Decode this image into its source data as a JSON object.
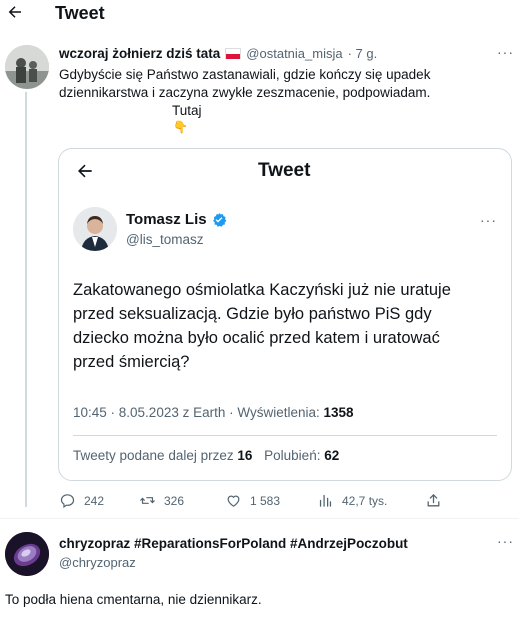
{
  "header": {
    "title": "Tweet"
  },
  "quote_tweet": {
    "author_name": "wczoraj żołnierz dziś tata",
    "author_handle": "@ostatnia_misja",
    "time": "· 7 g.",
    "text_line1": "Gdybyście się Państwo zastanawiali, gdzie kończy się upadek",
    "text_line2": "dziennikarstwa i zaczyna zwykłe zeszmacenie, podpowiadam.",
    "text_line3": "Tutaj",
    "pointing_emoji": "👇",
    "flag": "poland-flag-icon"
  },
  "embedded": {
    "header_title": "Tweet",
    "author_name": "Tomasz Lis",
    "author_handle": "@lis_tomasz",
    "text": [
      "Zakatowanego ośmiolatka Kaczyński już nie uratuje",
      "przed seksualizacją. Gdzie było państwo PiS gdy",
      "dziecko można było ocalić przed katem i uratować",
      "przed śmiercią?"
    ],
    "meta_prefix": "10:45 · 8.05.2023 z Earth · Wyświetlenia: ",
    "views": "1358",
    "retweets_label": "Tweety podane dalej przez ",
    "retweets": "16",
    "likes_label": "Polubień: ",
    "likes": "62"
  },
  "actions": {
    "replies": "242",
    "retweets": "326",
    "likes": "1 583",
    "views": "42,7 tys."
  },
  "reply": {
    "author_name": "chryzopraz #ReparationsForPoland #AndrzejPoczobut",
    "author_handle": "@chryzopraz",
    "text": "To podła hiena cmentarna, nie dziennikarz."
  },
  "colors": {
    "accent": "#1d9bf0",
    "border": "#cfd9de",
    "muted": "#536471",
    "flag_red": "#dc143c"
  }
}
